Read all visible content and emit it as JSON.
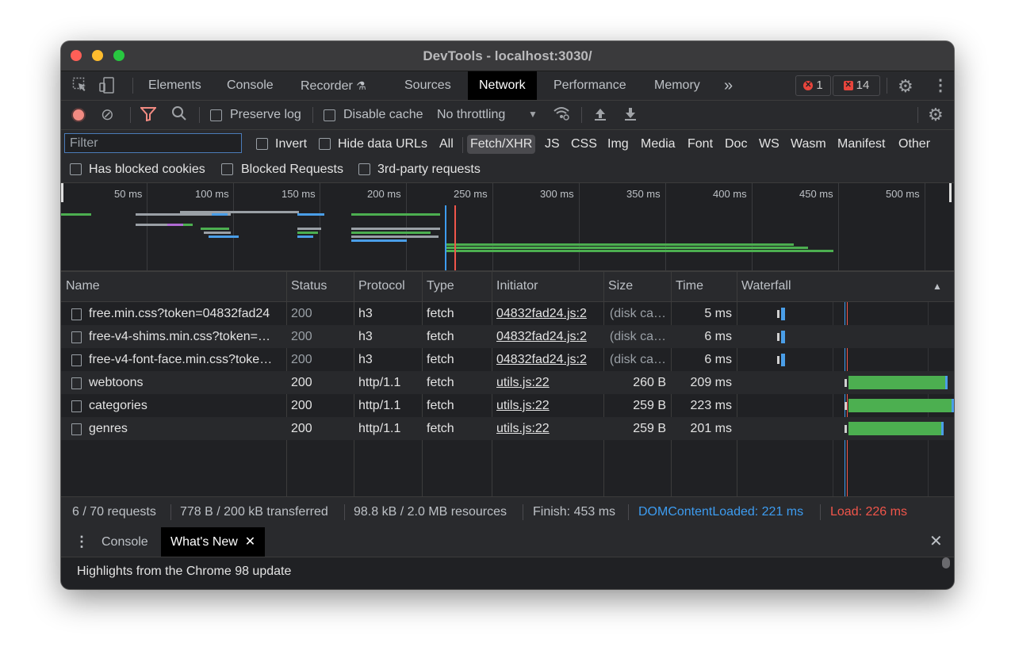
{
  "window": {
    "title": "DevTools - localhost:3030/"
  },
  "tabs": [
    "Elements",
    "Console",
    "Recorder",
    "Sources",
    "Network",
    "Performance",
    "Memory"
  ],
  "badges": {
    "errors": "1",
    "issues": "14"
  },
  "toolbar": {
    "preserve_log": "Preserve log",
    "disable_cache": "Disable cache",
    "throttling": "No throttling"
  },
  "filter": {
    "placeholder": "Filter",
    "invert": "Invert",
    "hide_data_urls": "Hide data URLs",
    "types": [
      "All",
      "Fetch/XHR",
      "JS",
      "CSS",
      "Img",
      "Media",
      "Font",
      "Doc",
      "WS",
      "Wasm",
      "Manifest",
      "Other"
    ],
    "active_type": "Fetch/XHR",
    "blocked_cookies": "Has blocked cookies",
    "blocked_requests": "Blocked Requests",
    "third_party": "3rd-party requests"
  },
  "overview": {
    "ticks": [
      "50 ms",
      "100 ms",
      "150 ms",
      "200 ms",
      "250 ms",
      "300 ms",
      "350 ms",
      "400 ms",
      "450 ms",
      "500 ms"
    ]
  },
  "table": {
    "columns": [
      "Name",
      "Status",
      "Protocol",
      "Type",
      "Initiator",
      "Size",
      "Time",
      "Waterfall"
    ],
    "rows": [
      {
        "name": "free.min.css?token=04832fad24",
        "status": "200",
        "protocol": "h3",
        "type": "fetch",
        "initiator": "04832fad24.js:2",
        "size": "(disk ca…",
        "time": "5 ms",
        "cached": true
      },
      {
        "name": "free-v4-shims.min.css?token=…",
        "status": "200",
        "protocol": "h3",
        "type": "fetch",
        "initiator": "04832fad24.js:2",
        "size": "(disk ca…",
        "time": "6 ms",
        "cached": true
      },
      {
        "name": "free-v4-font-face.min.css?toke…",
        "status": "200",
        "protocol": "h3",
        "type": "fetch",
        "initiator": "04832fad24.js:2",
        "size": "(disk ca…",
        "time": "6 ms",
        "cached": true
      },
      {
        "name": "webtoons",
        "status": "200",
        "protocol": "http/1.1",
        "type": "fetch",
        "initiator": "utils.js:22",
        "size": "260 B",
        "time": "209 ms",
        "cached": false
      },
      {
        "name": "categories",
        "status": "200",
        "protocol": "http/1.1",
        "type": "fetch",
        "initiator": "utils.js:22",
        "size": "259 B",
        "time": "223 ms",
        "cached": false
      },
      {
        "name": "genres",
        "status": "200",
        "protocol": "http/1.1",
        "type": "fetch",
        "initiator": "utils.js:22",
        "size": "259 B",
        "time": "201 ms",
        "cached": false
      }
    ]
  },
  "status": {
    "requests": "6 / 70 requests",
    "transferred": "778 B / 200 kB transferred",
    "resources": "98.8 kB / 2.0 MB resources",
    "finish": "Finish: 453 ms",
    "dcl": "DOMContentLoaded: 221 ms",
    "load": "Load: 226 ms"
  },
  "drawer": {
    "tabs": [
      "Console",
      "What's New"
    ],
    "highlight": "Highlights from the Chrome 98 update"
  },
  "colors": {
    "dcl": "#3d9cf0",
    "load": "#f0554a",
    "bar_green": "#4caf50",
    "bar_blue": "#4a9ee8"
  }
}
